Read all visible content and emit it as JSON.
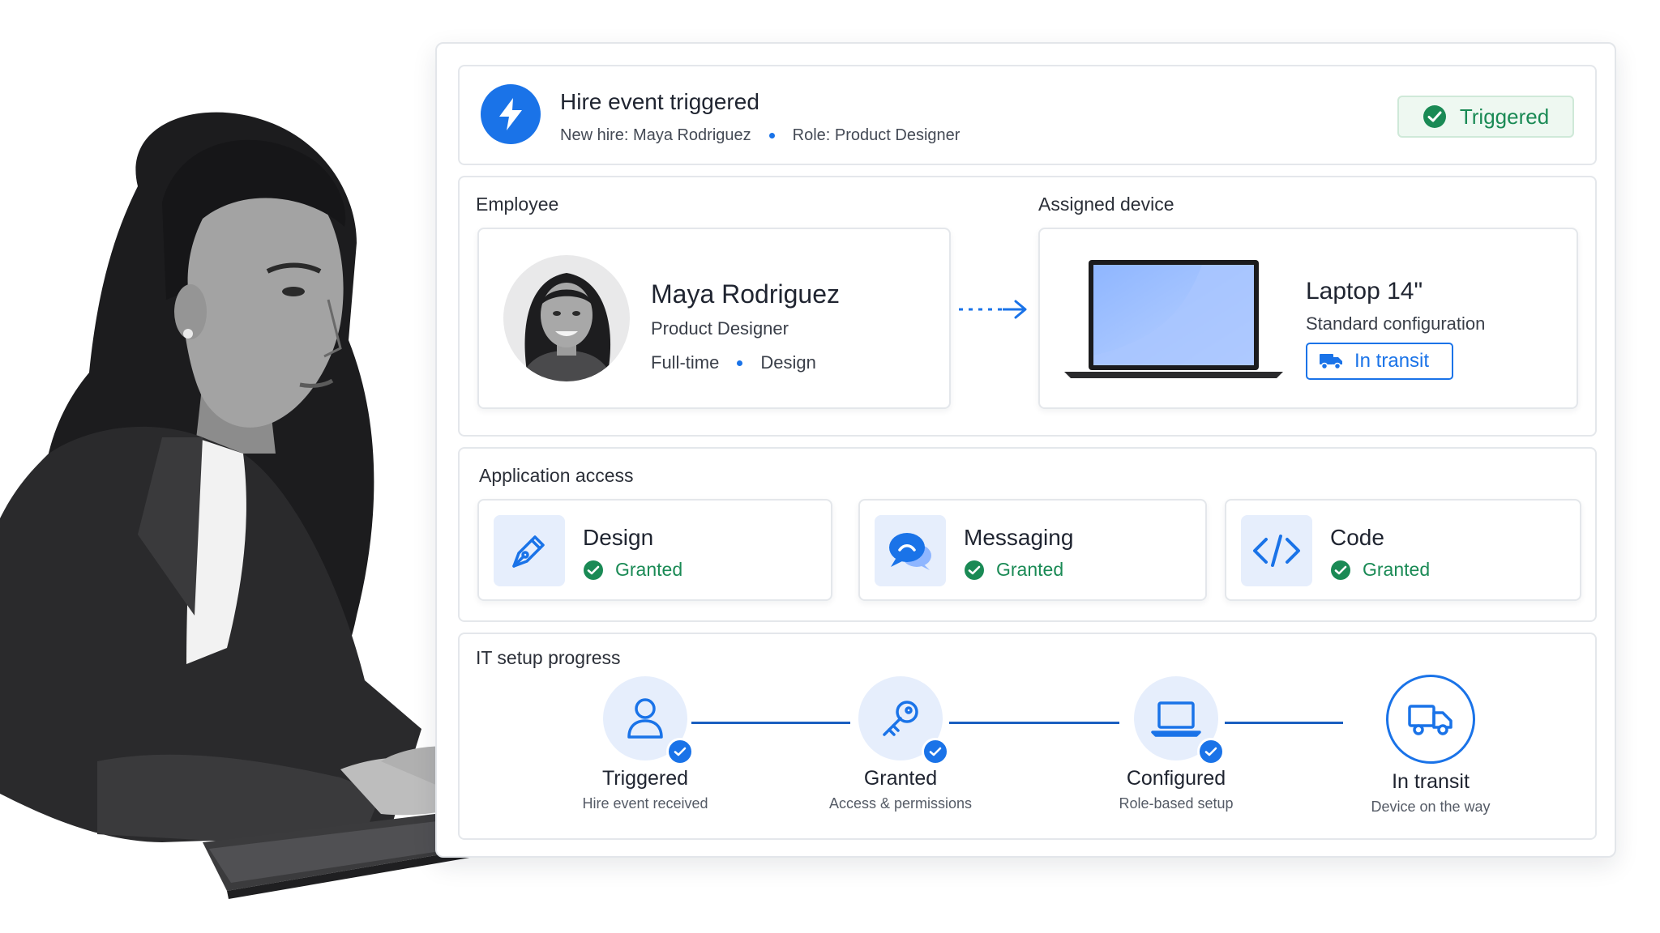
{
  "colors": {
    "accent": "#1a73e8",
    "success": "#1a8a55",
    "success_bg": "#eef8f1",
    "icon_bg": "#e6eefc"
  },
  "hire": {
    "title": "Hire event triggered",
    "new_hire": "New hire: Maya Rodriguez",
    "role": "Role: Product Designer",
    "status": "Triggered",
    "icon": "lightning-bolt-icon"
  },
  "employee": {
    "section_title": "Employee",
    "name": "Maya Rodriguez",
    "role": "Product Designer",
    "employment": "Full-time",
    "department": "Design"
  },
  "device": {
    "section_title": "Assigned device",
    "name": "Laptop 14\"",
    "config": "Standard configuration",
    "status": "In transit"
  },
  "apps": {
    "section_title": "Application access",
    "items": [
      {
        "name": "Design",
        "status": "Granted",
        "icon": "pen-nib-icon"
      },
      {
        "name": "Messaging",
        "status": "Granted",
        "icon": "chat-bubble-icon"
      },
      {
        "name": "Code",
        "status": "Granted",
        "icon": "code-brackets-icon"
      }
    ]
  },
  "progress": {
    "section_title": "IT setup progress",
    "steps": [
      {
        "label": "Triggered",
        "sub": "Hire event received",
        "icon": "user-icon",
        "done": true
      },
      {
        "label": "Granted",
        "sub": "Access & permissions",
        "icon": "key-icon",
        "done": true
      },
      {
        "label": "Configured",
        "sub": "Role-based setup",
        "icon": "laptop-icon",
        "done": true
      },
      {
        "label": "In transit",
        "sub": "Device on the way",
        "icon": "truck-icon",
        "done": false
      }
    ]
  }
}
